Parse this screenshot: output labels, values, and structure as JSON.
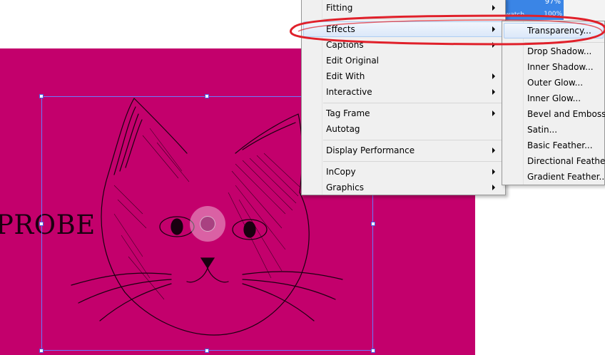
{
  "artwork": {
    "text": "PROBE",
    "background_color": "#c3006c"
  },
  "background_panel": {
    "percent_value": "97%",
    "swatch_label": "watch",
    "swatch_value": "100%"
  },
  "context_menu": {
    "items": [
      {
        "label": "Fitting",
        "has_submenu": true
      },
      {
        "label": "Effects",
        "has_submenu": true,
        "highlighted": true
      },
      {
        "label": "Captions",
        "has_submenu": true
      },
      {
        "label": "Edit Original",
        "has_submenu": false
      },
      {
        "label": "Edit With",
        "has_submenu": true
      },
      {
        "label": "Interactive",
        "has_submenu": true
      },
      {
        "label": "Tag Frame",
        "has_submenu": true
      },
      {
        "label": "Autotag",
        "has_submenu": false
      },
      {
        "label": "Display Performance",
        "has_submenu": true
      },
      {
        "label": "InCopy",
        "has_submenu": true
      },
      {
        "label": "Graphics",
        "has_submenu": true
      }
    ]
  },
  "effects_submenu": {
    "items": [
      {
        "label": "Transparency...",
        "highlighted": true
      },
      {
        "label": "Drop Shadow..."
      },
      {
        "label": "Inner Shadow..."
      },
      {
        "label": "Outer Glow..."
      },
      {
        "label": "Inner Glow..."
      },
      {
        "label": "Bevel and Emboss..."
      },
      {
        "label": "Satin..."
      },
      {
        "label": "Basic Feather..."
      },
      {
        "label": "Directional Feather..."
      },
      {
        "label": "Gradient Feather..."
      }
    ]
  },
  "annotation": {
    "color": "#e0202a"
  }
}
